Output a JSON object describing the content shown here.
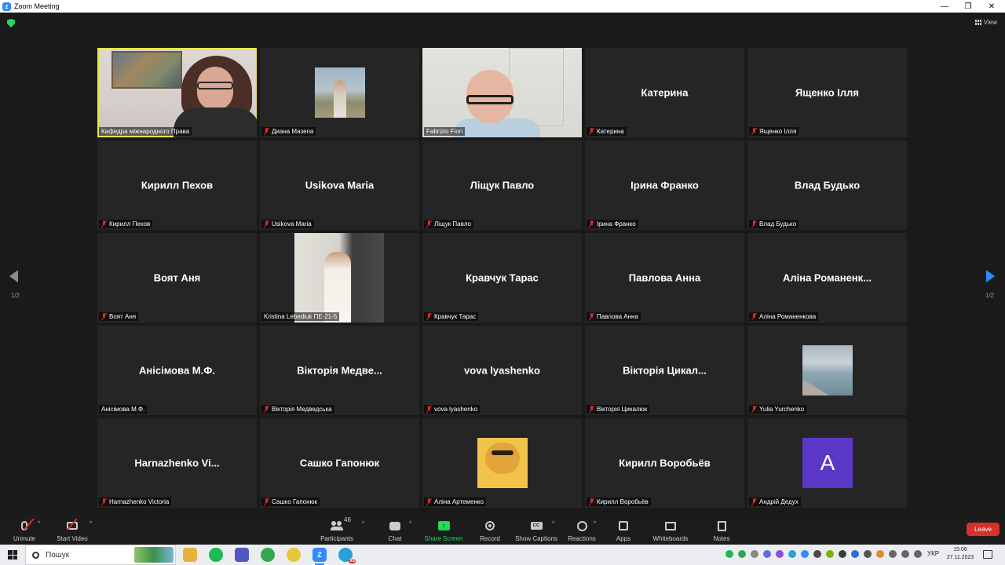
{
  "window": {
    "title": "Zoom Meeting",
    "controls": [
      "—",
      "❐",
      "✕"
    ]
  },
  "top": {
    "view_label": "View"
  },
  "pager": {
    "left": "1/2",
    "right": "1/2"
  },
  "tiles": [
    {
      "big": "",
      "label": "Кафедра міжнародного Права",
      "muted": false,
      "media": "video-room",
      "active": true
    },
    {
      "big": "",
      "label": "Диана Мазепа",
      "muted": true,
      "media": "photo-diana"
    },
    {
      "big": "",
      "label": "Fabrizio Fiori",
      "muted": false,
      "media": "video-fabrizio"
    },
    {
      "big": "Катерина",
      "label": "Катерина",
      "muted": true
    },
    {
      "big": "Ященко Ілля",
      "label": "Ященко Ілля",
      "muted": true
    },
    {
      "big": "Кирилл Пехов",
      "label": "Кирилл Пехов",
      "muted": true
    },
    {
      "big": "Usikova Maria",
      "label": "Usikova Maria",
      "muted": true
    },
    {
      "big": "Ліщук Павло",
      "label": "Ліщук Павло",
      "muted": true
    },
    {
      "big": "Ірина Франко",
      "label": "Ірина Франко",
      "muted": true
    },
    {
      "big": "Влад Будько",
      "label": "Влад Будько",
      "muted": true
    },
    {
      "big": "Воят Аня",
      "label": "Воят Аня",
      "muted": true
    },
    {
      "big": "",
      "label": "Kristina Lebediuk ПЕ-21-5",
      "muted": false,
      "media": "photo-kristina"
    },
    {
      "big": "Кравчук Тарас",
      "label": "Кравчук Тарас",
      "muted": true
    },
    {
      "big": "Павлова Анна",
      "label": "Павлова Анна",
      "muted": true
    },
    {
      "big": "Аліна Романенк...",
      "label": "Аліна Романенкова",
      "muted": true
    },
    {
      "big": "Анісімова М.Ф.",
      "label": "Анісімова М.Ф.",
      "muted": false
    },
    {
      "big": "Вікторія Медве...",
      "label": "Вікторія Медведська",
      "muted": true
    },
    {
      "big": "vova lyashenko",
      "label": "vova lyashenko",
      "muted": true
    },
    {
      "big": "Вікторія Цикал...",
      "label": "Вікторія Цикалюк",
      "muted": true
    },
    {
      "big": "",
      "label": "Yulia Yurchenko",
      "muted": true,
      "media": "photo-yulia"
    },
    {
      "big": "Harnazhenko Vi...",
      "label": "Harnazhenko Victoria",
      "muted": true
    },
    {
      "big": "Сашко Гапонюк",
      "label": "Сашко Гапонюк",
      "muted": true
    },
    {
      "big": "",
      "label": "Аліна Артеменко",
      "muted": true,
      "media": "photo-meme"
    },
    {
      "big": "Кирилл Воробьёв",
      "label": "Кирилл Воробьёв",
      "muted": true
    },
    {
      "big": "",
      "label": "Андрій Дедух",
      "muted": true,
      "media": "avatar",
      "avatar_letter": "A"
    }
  ],
  "toolbar": {
    "unmute": "Unmute",
    "start_video": "Start Video",
    "participants": "Participants",
    "participants_count": "46",
    "chat": "Chat",
    "share_screen": "Share Screen",
    "share_arrow": "↑",
    "record": "Record",
    "show_captions": "Show Captions",
    "captions_icon": "CC",
    "reactions": "Reactions",
    "apps": "Apps",
    "whiteboards": "Whiteboards",
    "notes": "Notes",
    "leave": "Leave",
    "caret": "^"
  },
  "taskbar": {
    "search_placeholder": "Пошук",
    "language": "УКР",
    "time": "15:06",
    "date": "27.11.2023",
    "tray_badge": "93"
  },
  "colors": {
    "zoom_blue": "#2d8cff",
    "share_green": "#23d959",
    "leave_red": "#d9302c",
    "active_speaker": "#e6e64a"
  }
}
